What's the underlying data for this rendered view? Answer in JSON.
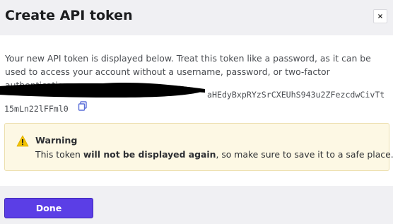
{
  "dialog": {
    "title": "Create API token",
    "close_label": "×"
  },
  "body": {
    "description": "Your new API token is displayed below. Treat this token like a password, as it can be used to access your account without a username, password, or two-factor authentication.",
    "token_line1": "aHEdyBxpRYzSrCXEUhS943u2ZFezcdwCivTt",
    "token_line2": "15mLn22lFFml0",
    "copy_icon": "copy-icon",
    "redaction": "redaction-mark"
  },
  "warning": {
    "icon": "warning-icon",
    "title": "Warning",
    "text_before": "This token ",
    "text_bold": "will not be displayed again",
    "text_after": ", so make sure to save it to a safe place."
  },
  "footer": {
    "done_label": "Done"
  },
  "colors": {
    "primary": "#5b3ee6",
    "header_bg": "#f0f0f3",
    "warning_bg": "#fdf8e4",
    "warning_border": "#ecdfae",
    "warning_icon": "#f2c200"
  }
}
